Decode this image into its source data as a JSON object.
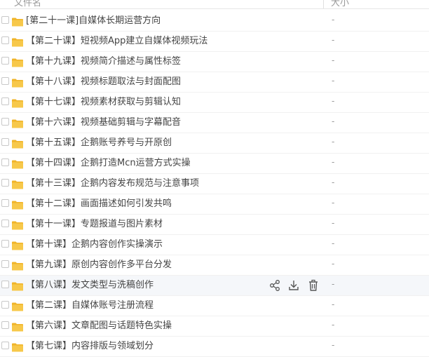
{
  "header": {
    "name_col": "文件名",
    "size_col": "大小"
  },
  "rows": [
    {
      "name": "[第二十一课]自媒体长期运营方向",
      "size": "-"
    },
    {
      "name": "【第二十课】短视频App建立自媒体视频玩法",
      "size": "-"
    },
    {
      "name": "【第十九课】视频简介描述与属性标签",
      "size": "-"
    },
    {
      "name": "【第十八课】视频标题取法与封面配图",
      "size": "-"
    },
    {
      "name": "【第十七课】视频素材获取与剪辑认知",
      "size": "-"
    },
    {
      "name": "【第十六课】视频基础剪辑与字幕配音",
      "size": "-"
    },
    {
      "name": "【第十五课】企鹅账号养号与开原创",
      "size": "-"
    },
    {
      "name": "【第十四课】企鹅打造Mcn运营方式实操",
      "size": "-"
    },
    {
      "name": "【第十三课】企鹅内容发布规范与注意事项",
      "size": "-"
    },
    {
      "name": "【第十二课】画面描述如何引发共鸣",
      "size": "-"
    },
    {
      "name": "【第十一课】专题报道与图片素材",
      "size": "-"
    },
    {
      "name": "【第十课】企鹅内容创作实操演示",
      "size": "-"
    },
    {
      "name": "【第九课】原创内容创作多平台分发",
      "size": "-"
    },
    {
      "name": "【第八课】发文类型与洗稿创作",
      "size": "-"
    },
    {
      "name": "【第二课】自媒体账号注册流程",
      "size": "-"
    },
    {
      "name": "【第六课】文章配图与话题特色实操",
      "size": "-"
    },
    {
      "name": "【第七课】内容排版与领域划分",
      "size": "-"
    }
  ],
  "hover_row_index": 13,
  "icons": {
    "folder": "folder-icon",
    "share": "share-icon",
    "download": "download-icon",
    "delete": "trash-icon"
  },
  "colors": {
    "folder": "#f7c84a",
    "folder_tab": "#f0b429",
    "hover_bg": "#f5f7fa"
  }
}
